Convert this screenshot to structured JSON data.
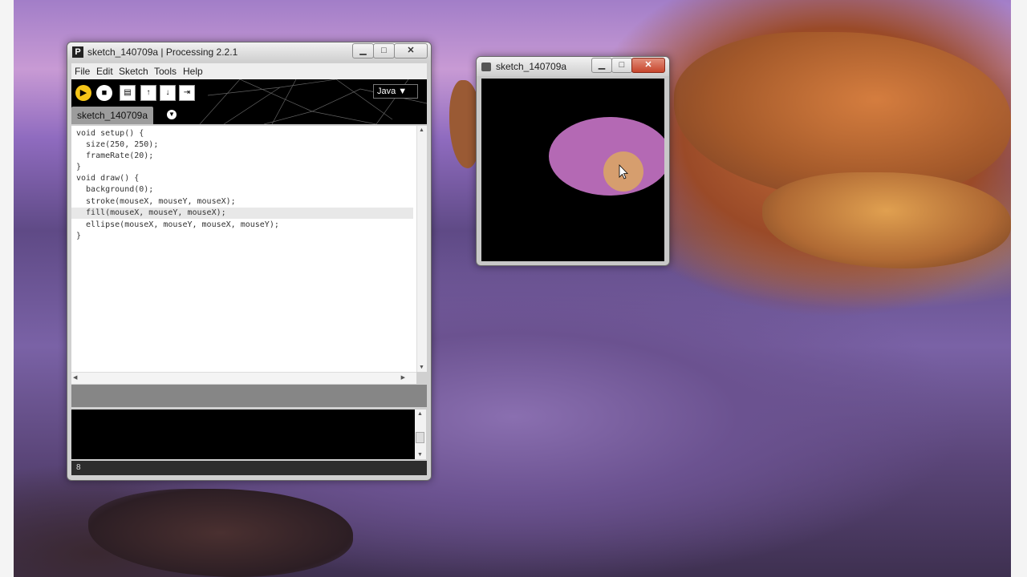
{
  "ide": {
    "title": "sketch_140709a | Processing 2.2.1",
    "app_icon": "P",
    "menus": [
      "File",
      "Edit",
      "Sketch",
      "Tools",
      "Help"
    ],
    "toolbar": {
      "run": "▶",
      "stop": "■",
      "new": "▤",
      "open": "↑",
      "save": "↓",
      "export": "⇥"
    },
    "mode": "Java ▼",
    "tab": "sketch_140709a",
    "tab_arrow": "▼",
    "code": [
      "void setup() {",
      "  size(250, 250);",
      "  frameRate(20);",
      "}",
      "void draw() {",
      "  background(0);",
      "  stroke(mouseX, mouseY, mouseX);",
      "  fill(mouseX, mouseY, mouseX);",
      "  ellipse(mouseX, mouseY, mouseX, mouseY);",
      "}"
    ],
    "line_number": "8",
    "window_controls": {
      "minimize": "▁",
      "maximize": "□",
      "close": "✕"
    }
  },
  "sketch": {
    "title": "sketch_140709a",
    "window_controls": {
      "minimize": "▁",
      "maximize": "□",
      "close": "✕"
    },
    "ellipse_color": "#b469b4",
    "cursor_circle_color": "#d69e6e",
    "cursor": "arrow-pointer"
  }
}
